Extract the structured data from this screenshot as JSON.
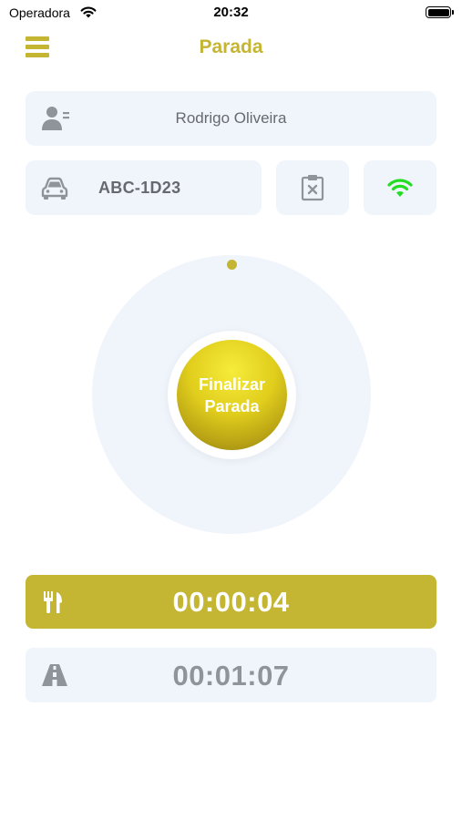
{
  "status_bar": {
    "carrier": "Operadora",
    "time": "20:32"
  },
  "header": {
    "title": "Parada"
  },
  "driver": {
    "name": "Rodrigo Oliveira"
  },
  "vehicle": {
    "plate": "ABC-1D23"
  },
  "stop_button": {
    "line1": "Finalizar",
    "line2": "Parada"
  },
  "timers": {
    "meal": "00:00:04",
    "drive": "00:01:07"
  },
  "colors": {
    "accent": "#c4b533",
    "card_background": "#f0f5fc",
    "signal": "#22dd22",
    "muted_icon": "#8f949a"
  },
  "icons": {
    "menu": "hamburger-icon",
    "driver": "driver-id-icon",
    "vehicle": "car-icon",
    "clipboard": "clipboard-x-icon",
    "signal": "wifi-icon",
    "meal": "fork-knife-icon",
    "drive": "road-icon"
  }
}
